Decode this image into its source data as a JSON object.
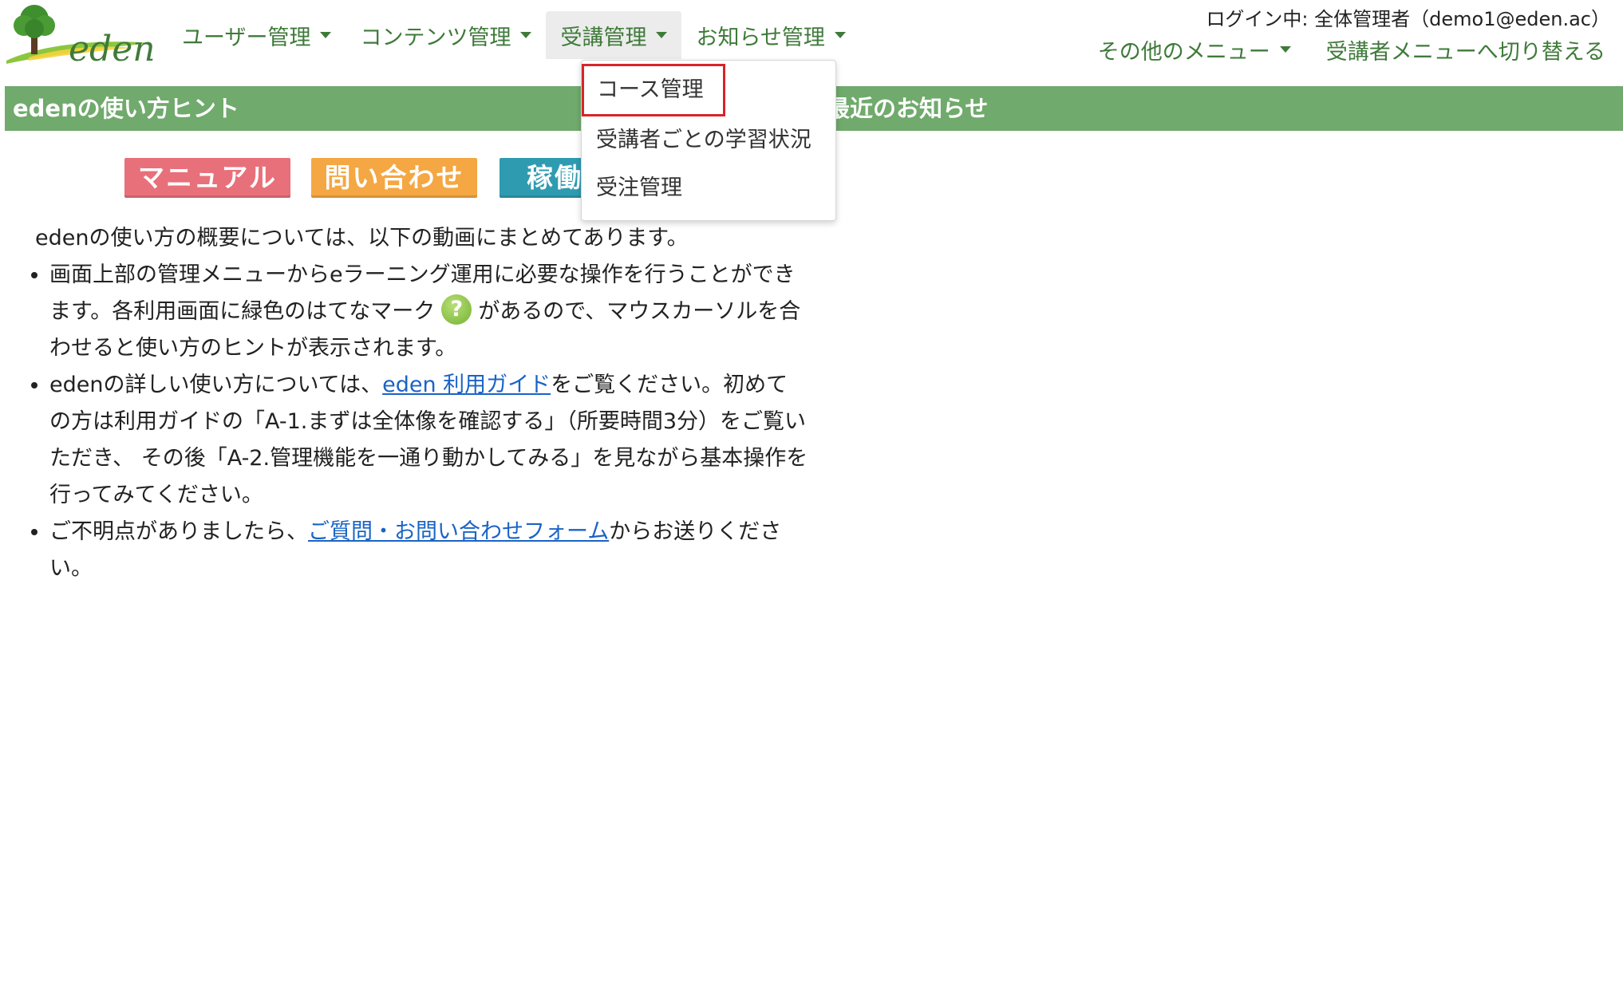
{
  "header": {
    "logo_text": "eden",
    "nav": [
      {
        "label": "ユーザー管理"
      },
      {
        "label": "コンテンツ管理"
      },
      {
        "label": "受講管理"
      },
      {
        "label": "お知らせ管理"
      }
    ],
    "login_info": "ログイン中: 全体管理者（demo1@eden.ac）",
    "other_menu": "その他のメニュー",
    "switch_menu": "受講者メニューへ切り替える"
  },
  "dropdown": {
    "items": [
      "コース管理",
      "受講者ごとの学習状況",
      "受注管理"
    ]
  },
  "sections": {
    "left_title": "edenの使い方ヒント",
    "right_title": "最近のお知らせ"
  },
  "badges": {
    "manual": "マニュアル",
    "contact": "問い合わせ",
    "status": "稼働状況"
  },
  "content": {
    "intro": "edenの使い方の概要については、以下の動画にまとめてあります。",
    "tip1_before": "画面上部の管理メニューからeラーニング運用に必要な操作を行うことができます。各利用画面に緑色のはてなマーク",
    "qmark": "?",
    "tip1_after": "があるので、マウスカーソルを合わせると使い方のヒントが表示されます。",
    "tip2_before": "edenの詳しい使い方については、",
    "tip2_link": "eden 利用ガイド",
    "tip2_after": "をご覧ください。初めての方は利用ガイドの「A-1.まずは全体像を確認する」（所要時間3分）をご覧いただき、 その後「A-2.管理機能を一通り動かしてみる」を見ながら基本操作を行ってみてください。",
    "tip3_before": "ご不明点がありましたら、",
    "tip3_link": "ご質問・お問い合わせフォーム",
    "tip3_after": "からお送りください。"
  },
  "colors": {
    "brand_green": "#70aa6c",
    "nav_text": "#3f7a3a",
    "link": "#1a63c6",
    "highlight_border": "#d8232a"
  }
}
